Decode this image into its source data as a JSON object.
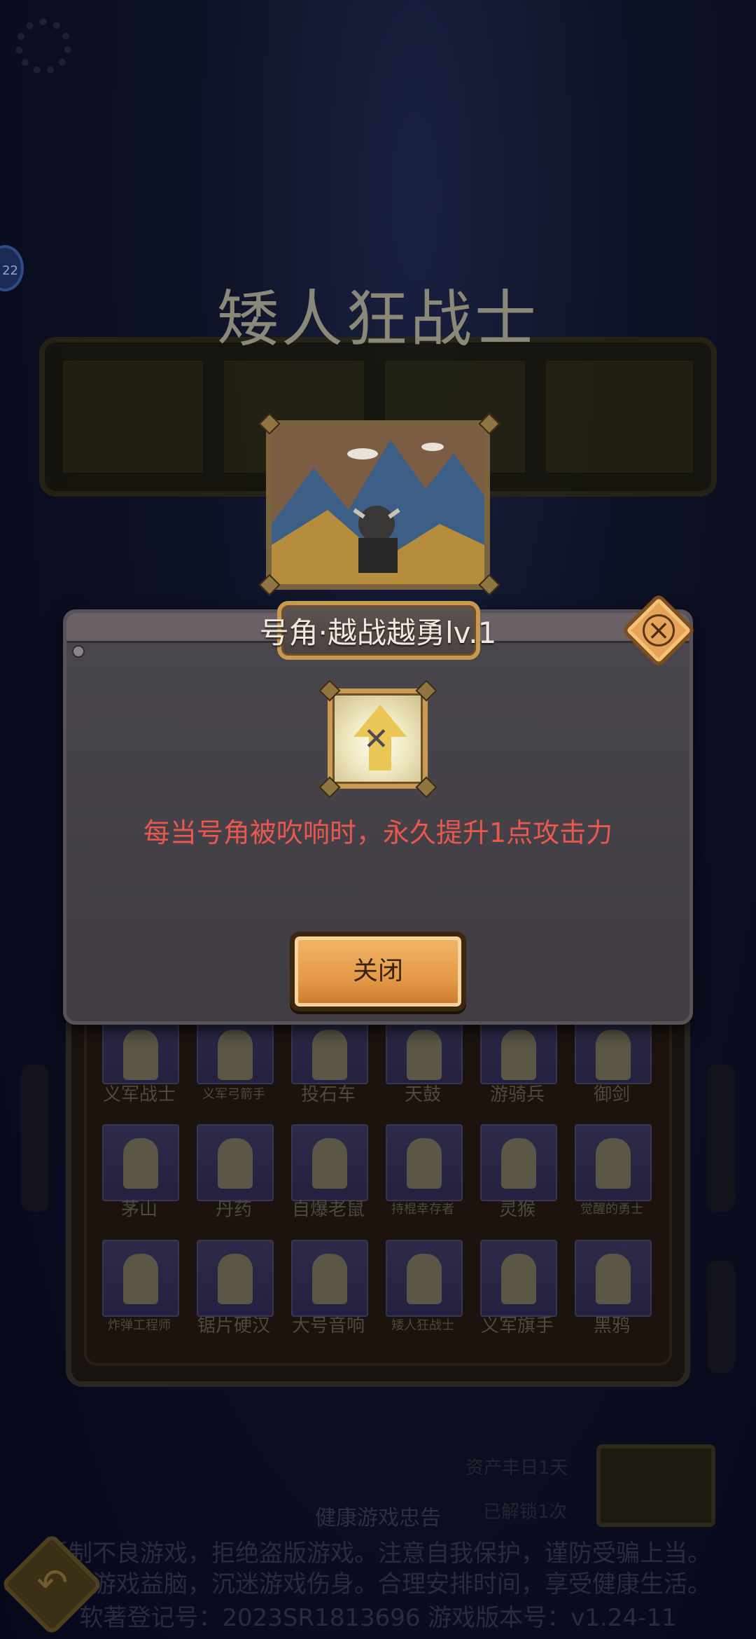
{
  "hero": {
    "name": "矮人狂战士"
  },
  "dialog": {
    "title": "号角·越战越勇lv.1",
    "description": "每当号角被吹响时，永久提升1点攻击力",
    "close_label": "关闭"
  },
  "units": [
    {
      "label": "义军战士"
    },
    {
      "label": "义军弓箭手"
    },
    {
      "label": "投石车"
    },
    {
      "label": "天鼓"
    },
    {
      "label": "游骑兵"
    },
    {
      "label": "御剑"
    },
    {
      "label": "茅山"
    },
    {
      "label": "丹药"
    },
    {
      "label": "自爆老鼠"
    },
    {
      "label": "持棍幸存者"
    },
    {
      "label": "灵猴"
    },
    {
      "label": "觉醒的勇士"
    },
    {
      "label": "炸弹工程师"
    },
    {
      "label": "锯片硬汉"
    },
    {
      "label": "大号音响"
    },
    {
      "label": "矮人狂战士"
    },
    {
      "label": "义军旗手"
    },
    {
      "label": "黑鸦"
    }
  ],
  "footer": {
    "health_title": "健康游戏忠告",
    "line1": "抵制不良游戏，拒绝盗版游戏。注意自我保护，谨防受骗上当。",
    "line2": "适度游戏益脑，沉迷游戏伤身。合理安排时间，享受健康生活。",
    "line3": "软著登记号：2023SR1813696   游戏版本号：v1.24-11"
  },
  "side_badge": "22",
  "shop": {
    "line1": "资产丰日1天",
    "line2": "已解锁1次"
  },
  "colors": {
    "accent_gold": "#c89a52",
    "desc_red": "#e8584e",
    "button_orange": "#e49a48"
  }
}
